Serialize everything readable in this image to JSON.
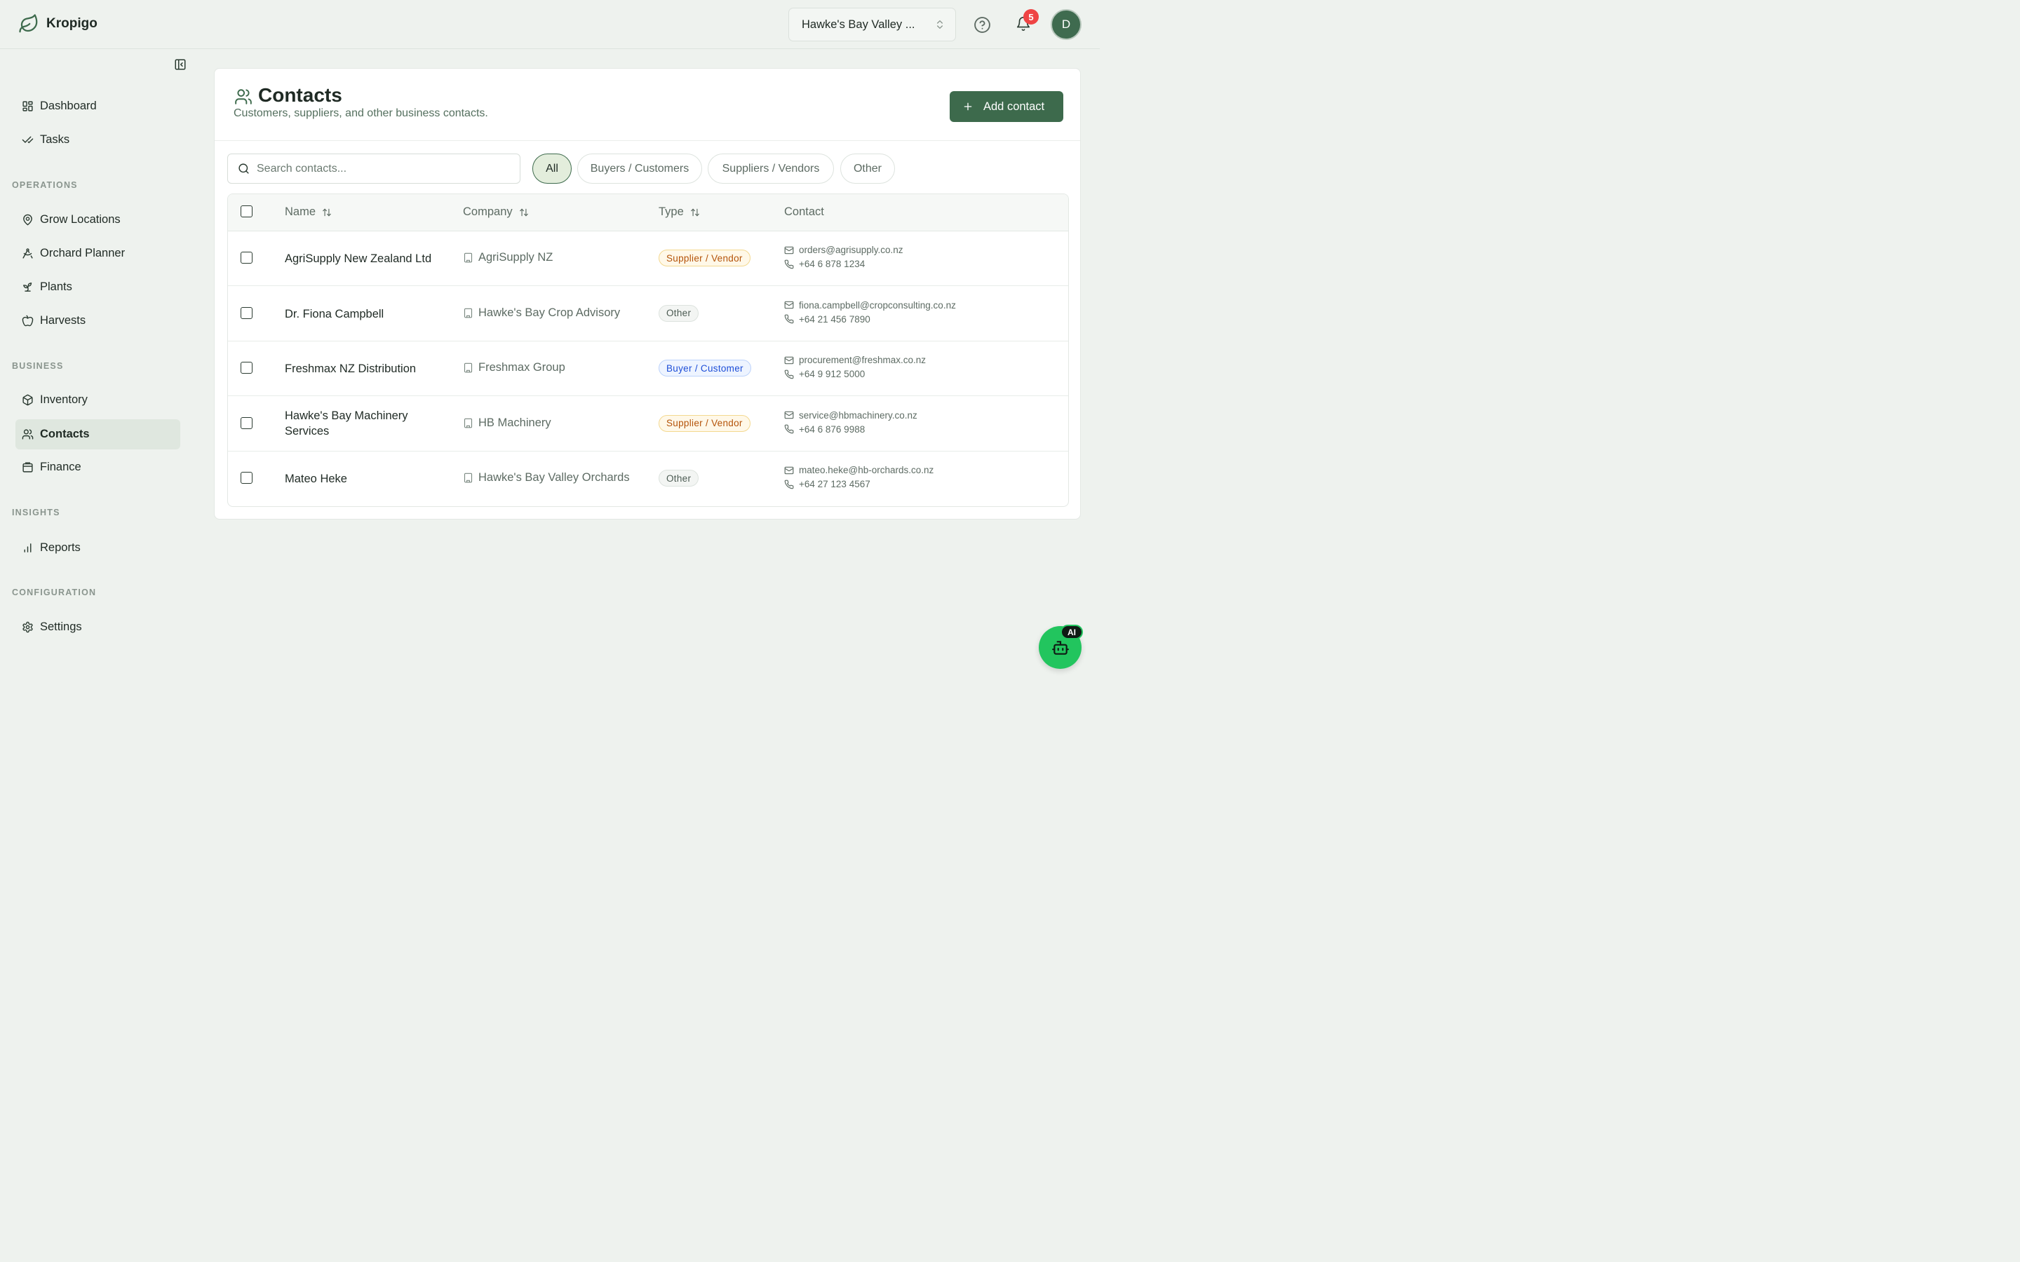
{
  "brand": {
    "name": "Kropigo"
  },
  "header": {
    "org_selector": "Hawke's Bay Valley ...",
    "notification_count": "5",
    "avatar_initial": "D"
  },
  "sidebar": {
    "top_items": [
      {
        "label": "Dashboard",
        "icon": "dashboard-icon"
      },
      {
        "label": "Tasks",
        "icon": "check-icon"
      }
    ],
    "sections": [
      {
        "label": "OPERATIONS",
        "items": [
          {
            "label": "Grow Locations",
            "icon": "map-pin-icon"
          },
          {
            "label": "Orchard Planner",
            "icon": "planner-icon"
          },
          {
            "label": "Plants",
            "icon": "sprout-icon"
          },
          {
            "label": "Harvests",
            "icon": "apple-icon"
          }
        ]
      },
      {
        "label": "BUSINESS",
        "items": [
          {
            "label": "Inventory",
            "icon": "package-icon"
          },
          {
            "label": "Contacts",
            "icon": "users-icon",
            "active": true
          },
          {
            "label": "Finance",
            "icon": "wallet-icon"
          }
        ]
      },
      {
        "label": "INSIGHTS",
        "items": [
          {
            "label": "Reports",
            "icon": "bar-chart-icon"
          }
        ]
      },
      {
        "label": "CONFIGURATION",
        "items": [
          {
            "label": "Settings",
            "icon": "gear-icon"
          }
        ]
      }
    ]
  },
  "page": {
    "title": "Contacts",
    "subtitle": "Customers, suppliers, and other business contacts.",
    "add_button": "Add contact",
    "search_placeholder": "Search contacts...",
    "filters": [
      "All",
      "Buyers / Customers",
      "Suppliers / Vendors",
      "Other"
    ],
    "active_filter": "All"
  },
  "table": {
    "columns": [
      "Name",
      "Company",
      "Type",
      "Contact"
    ],
    "rows": [
      {
        "name": "AgriSupply New Zealand Ltd",
        "company": "AgriSupply NZ",
        "type": "Supplier / Vendor",
        "type_kind": "supplier",
        "email": "orders@agrisupply.co.nz",
        "phone": "+64 6 878 1234"
      },
      {
        "name": "Dr. Fiona Campbell",
        "company": "Hawke's Bay Crop Advisory",
        "type": "Other",
        "type_kind": "other",
        "email": "fiona.campbell@cropconsulting.co.nz",
        "phone": "+64 21 456 7890"
      },
      {
        "name": "Freshmax NZ Distribution",
        "company": "Freshmax Group",
        "type": "Buyer / Customer",
        "type_kind": "buyer",
        "email": "procurement@freshmax.co.nz",
        "phone": "+64 9 912 5000"
      },
      {
        "name": "Hawke's Bay Machinery Services",
        "company": "HB Machinery",
        "type": "Supplier / Vendor",
        "type_kind": "supplier",
        "email": "service@hbmachinery.co.nz",
        "phone": "+64 6 876 9988"
      },
      {
        "name": "Mateo Heke",
        "company": "Hawke's Bay Valley Orchards",
        "type": "Other",
        "type_kind": "other",
        "email": "mateo.heke@hb-orchards.co.nz",
        "phone": "+64 27 123 4567"
      }
    ]
  },
  "ai_assistant": {
    "badge": "AI"
  },
  "colors": {
    "accent": "#3d6a4c",
    "fab": "#22c55e",
    "badge_red": "#ef4444"
  }
}
